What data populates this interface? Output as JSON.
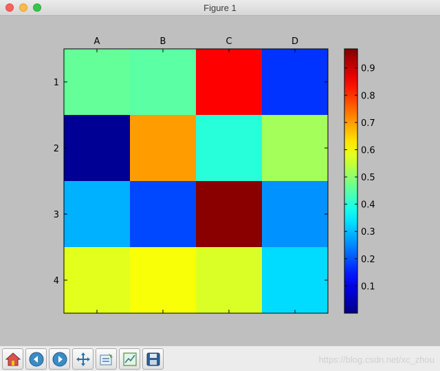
{
  "window": {
    "title": "Figure 1"
  },
  "chart_data": {
    "type": "heatmap",
    "columns": [
      "A",
      "B",
      "C",
      "D"
    ],
    "rows": [
      "1",
      "2",
      "3",
      "4"
    ],
    "values": [
      [
        0.46,
        0.45,
        0.85,
        0.17
      ],
      [
        0.02,
        0.7,
        0.4,
        0.52
      ],
      [
        0.29,
        0.19,
        0.96,
        0.26
      ],
      [
        0.58,
        0.6,
        0.57,
        0.33
      ]
    ],
    "colormap": "jet",
    "colorbar": {
      "min": 0.0,
      "max": 0.97,
      "ticks": [
        "0.1",
        "0.2",
        "0.3",
        "0.4",
        "0.5",
        "0.6",
        "0.7",
        "0.8",
        "0.9"
      ]
    },
    "title": "",
    "xlabel": "",
    "ylabel": "",
    "x_ticks_position": "top"
  },
  "toolbar": {
    "buttons": [
      "home",
      "back",
      "forward",
      "pan",
      "configure",
      "zoom",
      "save"
    ]
  },
  "watermark": "https://blog.csdn.net/xc_zhou"
}
